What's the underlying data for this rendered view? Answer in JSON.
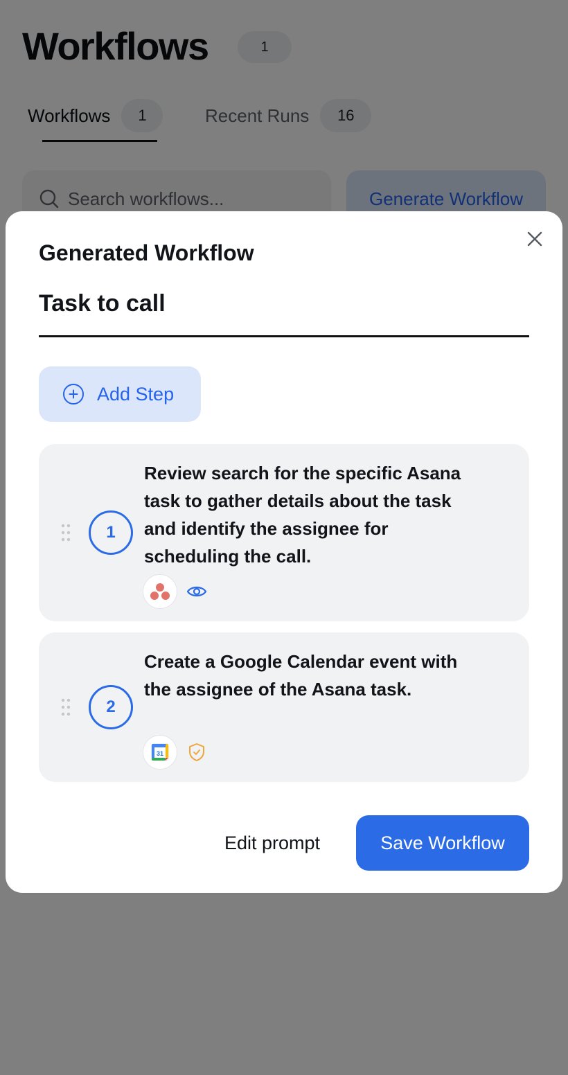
{
  "header": {
    "title": "Workflows",
    "count": "1"
  },
  "tabs": [
    {
      "label": "Workflows",
      "count": "1",
      "active": true
    },
    {
      "label": "Recent Runs",
      "count": "16",
      "active": false
    }
  ],
  "search": {
    "placeholder": "Search workflows..."
  },
  "toolbar": {
    "generate_label": "Generate Workflow"
  },
  "modal": {
    "title": "Generated Workflow",
    "workflow_name": "Task to call",
    "add_step_label": "Add Step",
    "steps": [
      {
        "number": "1",
        "text": "Review search for the specific Asana task to gather details about the task and identify the assignee for scheduling the call.",
        "app_icon": "asana-icon",
        "badge_icon": "eye-icon",
        "badge_color": "#2b6be6"
      },
      {
        "number": "2",
        "text": "Create a Google Calendar event with the assignee of the Asana task.",
        "app_icon": "google-calendar-icon",
        "app_icon_text": "31",
        "badge_icon": "shield-check-icon",
        "badge_color": "#f0a53a"
      }
    ],
    "edit_prompt_label": "Edit prompt",
    "save_label": "Save Workflow"
  },
  "colors": {
    "accent": "#2b6be6",
    "accent_light": "#dbe6fb",
    "card_bg": "#f1f2f4",
    "overlay": "rgba(0,0,0,0.5)",
    "asana": "#e2736b",
    "warning": "#f0a53a"
  }
}
